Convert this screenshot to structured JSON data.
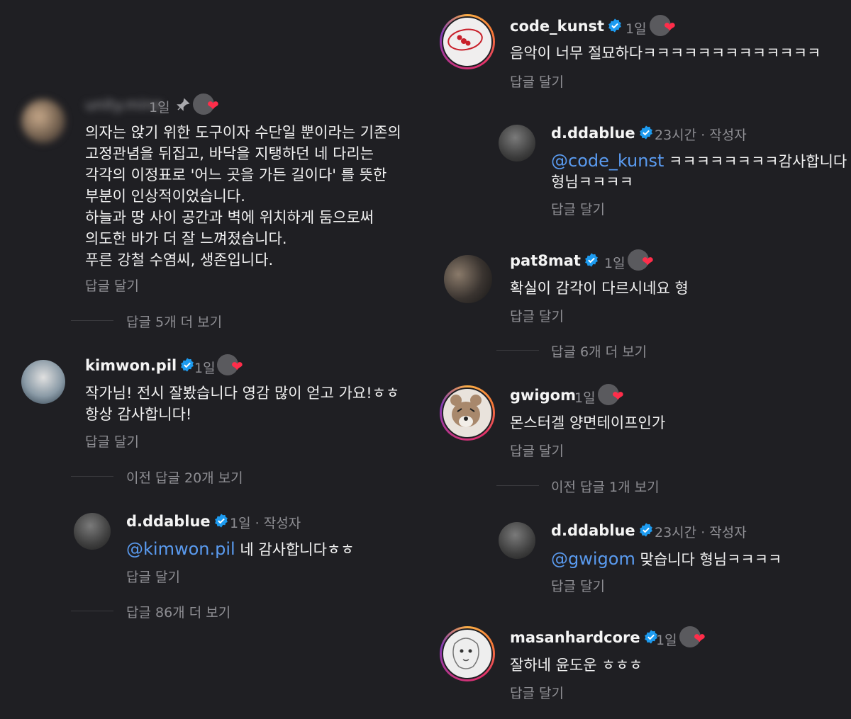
{
  "common": {
    "reply_label": "답글 달기",
    "time_1d": "1일",
    "time_23h": "23시간",
    "author_label": "작성자",
    "dot": "·"
  },
  "left": {
    "c1": {
      "username": "unity.mine",
      "time": "1일",
      "text": "의자는 앉기 위한 도구이자 수단일 뿐이라는 기존의\n고정관념을 뒤집고, 바닥을 지탱하던 네 다리는\n각각의 이정표로 '어느 곳을 가든 길이다' 를 뜻한\n부분이 인상적이었습니다.\n하늘과 땅 사이 공간과 벽에 위치하게 둠으로써\n의도한 바가 더 잘 느껴졌습니다.\n푸른 강철 수염씨, 생존입니다.",
      "reply": "답글 달기",
      "more": "답글 5개 더 보기"
    },
    "c2": {
      "username": "kimwon.pil",
      "time": "1일",
      "text": "작가님! 전시 잘봤습니다 영감 많이 얻고 가요!ㅎㅎ\n항상 감사합니다!",
      "reply": "답글 달기",
      "more": "이전 답글 20개 보기"
    },
    "c3": {
      "username": "d.ddablue",
      "time": "1일",
      "author": "작성자",
      "mention": "@kimwon.pil",
      "text": " 네 감사합니다ㅎㅎ",
      "reply": "답글 달기",
      "more": "답글 86개 더 보기"
    }
  },
  "right": {
    "c1": {
      "username": "code_kunst",
      "time": "1일",
      "text": "음악이 너무 절묘하다ㅋㅋㅋㅋㅋㅋㅋㅋㅋㅋㅋㅋㅋ",
      "reply": "답글 달기"
    },
    "c2": {
      "username": "d.ddablue",
      "time": "23시간",
      "author": "작성자",
      "mention": "@code_kunst",
      "text1": " ㅋㅋㅋㅋㅋㅋㅋㅋ감사합니다",
      "text2": "형님ㅋㅋㅋㅋ",
      "reply": "답글 달기"
    },
    "c3": {
      "username": "pat8mat",
      "time": "1일",
      "text": "확실이 감각이 다르시네요 형",
      "reply": "답글 달기",
      "more": "답글 6개 더 보기"
    },
    "c4": {
      "username": "gwigom",
      "time": "1일",
      "text": "몬스터겔 양면테이프인가",
      "reply": "답글 달기",
      "more": "이전 답글 1개 보기"
    },
    "c5": {
      "username": "d.ddablue",
      "time": "23시간",
      "author": "작성자",
      "mention": "@gwigom",
      "text": " 맞습니다 형님ㅋㅋㅋㅋ",
      "reply": "답글 달기"
    },
    "c6": {
      "username": "masanhardcore",
      "time": "1일",
      "text": "잘하네 윤도운 ㅎㅎㅎ",
      "reply": "답글 달기"
    }
  },
  "colors": {
    "background": "#1f1f23",
    "text": "#f2f2f2",
    "muted": "#8e8e93",
    "mention": "#5a9bf0",
    "verified": "#1d9bf0",
    "heart": "#ff2d4a"
  }
}
